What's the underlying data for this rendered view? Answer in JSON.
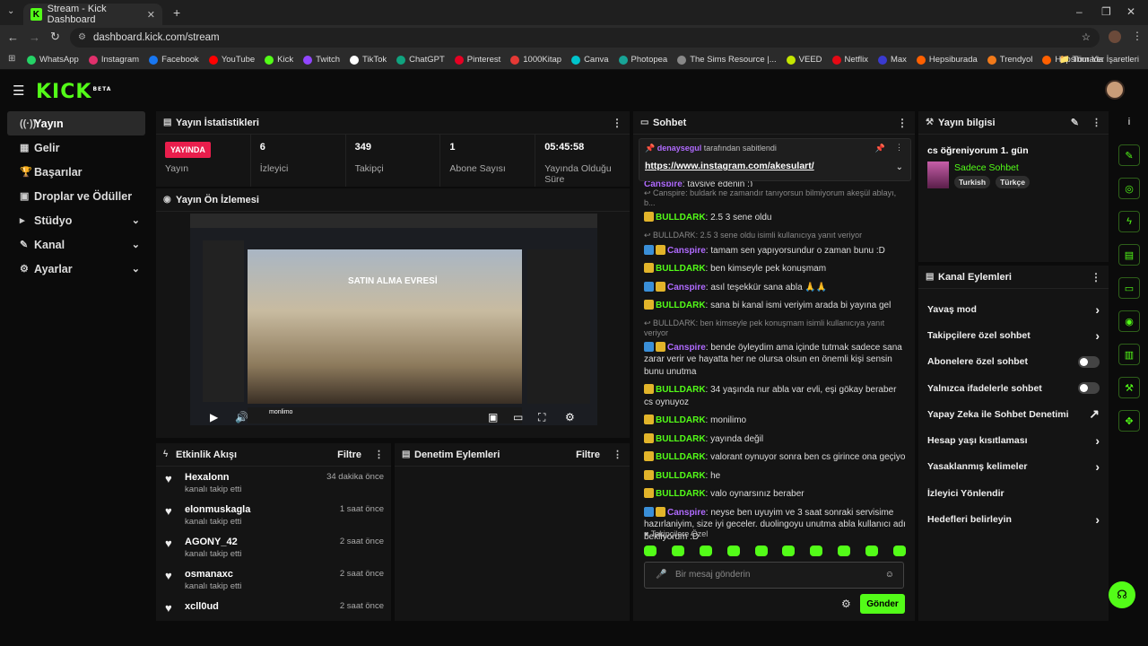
{
  "browser": {
    "tab_title": "Stream - Kick Dashboard",
    "url": "dashboard.kick.com/stream",
    "bookmarks": [
      {
        "label": "WhatsApp",
        "color": "#25d366"
      },
      {
        "label": "Instagram",
        "color": "#e1306c"
      },
      {
        "label": "Facebook",
        "color": "#1877f2"
      },
      {
        "label": "YouTube",
        "color": "#ff0000"
      },
      {
        "label": "Kick",
        "color": "#53fc18"
      },
      {
        "label": "Twitch",
        "color": "#9146ff"
      },
      {
        "label": "TikTok",
        "color": "#ffffff"
      },
      {
        "label": "ChatGPT",
        "color": "#10a37f"
      },
      {
        "label": "Pinterest",
        "color": "#e60023"
      },
      {
        "label": "1000Kitap",
        "color": "#e53935"
      },
      {
        "label": "Canva",
        "color": "#00c4cc"
      },
      {
        "label": "Photopea",
        "color": "#18a497"
      },
      {
        "label": "The Sims Resource |...",
        "color": "#888888"
      },
      {
        "label": "VEED",
        "color": "#c4e600"
      },
      {
        "label": "Netflix",
        "color": "#e50914"
      },
      {
        "label": "Max",
        "color": "#3a3ad0"
      },
      {
        "label": "Hepsiburada",
        "color": "#ff6000"
      },
      {
        "label": "Trendyol",
        "color": "#f27a1a"
      },
      {
        "label": "Hepsiburada",
        "color": "#ff6000"
      }
    ],
    "all_bookmarks": "Tüm Yer İşaretleri"
  },
  "app": {
    "logo": "KICK",
    "logo_sup": "BETA",
    "accent": "#53fc18"
  },
  "sidebar": {
    "items": [
      {
        "label": "Yayın",
        "icon": "broadcast-icon",
        "glyph": "((·))",
        "chev": ""
      },
      {
        "label": "Gelir",
        "icon": "revenue-icon",
        "glyph": "▦",
        "chev": ""
      },
      {
        "label": "Başarılar",
        "icon": "trophy-icon",
        "glyph": "🏆",
        "chev": ""
      },
      {
        "label": "Droplar ve Ödüller",
        "icon": "gift-icon",
        "glyph": "▣",
        "chev": ""
      },
      {
        "label": "Stüdyo",
        "icon": "studio-icon",
        "glyph": "▸",
        "chev": "⌄"
      },
      {
        "label": "Kanal",
        "icon": "channel-icon",
        "glyph": "✎",
        "chev": "⌄"
      },
      {
        "label": "Ayarlar",
        "icon": "settings-icon",
        "glyph": "⚙",
        "chev": "⌄"
      }
    ]
  },
  "stats": {
    "title": "Yayın İstatistikleri",
    "live_label": "YAYINDA",
    "live_caption": "Yayın",
    "items": [
      {
        "value": "6",
        "label": "İzleyici"
      },
      {
        "value": "349",
        "label": "Takipçi"
      },
      {
        "value": "1",
        "label": "Abone Sayısı"
      },
      {
        "value": "05:45:58",
        "label": "Yayında Olduğu Süre"
      }
    ]
  },
  "preview": {
    "title": "Yayın Ön İzlemesi",
    "overlay_text": "SATIN ALMA EVRESİ",
    "chat_user": "monlimo"
  },
  "activity": {
    "title": "Etkinlik Akışı",
    "filter": "Filtre",
    "events": [
      {
        "name": "Hexalonn",
        "desc": "kanalı takip etti",
        "time": "34 dakika önce"
      },
      {
        "name": "elonmuskagla",
        "desc": "kanalı takip etti",
        "time": "1 saat önce"
      },
      {
        "name": "AGONY_42",
        "desc": "kanalı takip etti",
        "time": "2 saat önce"
      },
      {
        "name": "osmanaxc",
        "desc": "kanalı takip etti",
        "time": "2 saat önce"
      },
      {
        "name": "xcll0ud",
        "desc": "",
        "time": "2 saat önce"
      }
    ]
  },
  "moderation": {
    "title": "Denetim Eylemleri",
    "filter": "Filtre"
  },
  "chat": {
    "title": "Sohbet",
    "pinned_by": "denaysegul",
    "pinned_suffix": "tarafından sabitlendi",
    "pinned_link": "https://www.instagram.com/akesulart/",
    "top_partial_user": "Canspire",
    "top_partial_text": ": tavsiye edenin :)",
    "messages": [
      {
        "type": "reply",
        "text": "Canspire: buldark ne zamandır tanıyorsun bilmiyorum akeşül ablayı, b..."
      },
      {
        "type": "msg",
        "user": "BULLDARK",
        "color": "green",
        "text": ": 2.5 3 sene oldu"
      },
      {
        "type": "reply",
        "text": "BULLDARK: 2.5 3 sene oldu isimli kullanıcıya yanıt veriyor"
      },
      {
        "type": "msg",
        "user": "Canspire",
        "color": "purple",
        "text": ": tamam sen yapıyorsundur o zaman bunu :D"
      },
      {
        "type": "msg",
        "user": "BULLDARK",
        "color": "green",
        "text": ": ben kimseyle pek konuşmam"
      },
      {
        "type": "msg",
        "user": "Canspire",
        "color": "purple",
        "text": ": asıl teşekkür sana abla 🙏🙏"
      },
      {
        "type": "msg",
        "user": "BULLDARK",
        "color": "green",
        "text": ": sana bi kanal ismi veriyim arada bi yayına gel"
      },
      {
        "type": "reply",
        "text": "BULLDARK: ben kimseyle pek konuşmam isimli kullanıcıya yanıt veriyor"
      },
      {
        "type": "msg",
        "user": "Canspire",
        "color": "purple",
        "text": ": bende öyleydim ama içinde tutmak sadece sana zarar verir ve hayatta her ne olursa olsun en önemli kişi sensin bunu unutma"
      },
      {
        "type": "msg",
        "user": "BULLDARK",
        "color": "green",
        "text": ": 34 yaşında nur abla var evli, eşi gökay beraber cs oynuyoz"
      },
      {
        "type": "msg",
        "user": "BULLDARK",
        "color": "green",
        "text": ": monilimo"
      },
      {
        "type": "msg",
        "user": "BULLDARK",
        "color": "green",
        "text": ": yayında değil"
      },
      {
        "type": "msg",
        "user": "BULLDARK",
        "color": "green",
        "text": ": valorant oynuyor sonra ben cs girince ona geçiyo"
      },
      {
        "type": "msg",
        "user": "BULLDARK",
        "color": "green",
        "text": ": he"
      },
      {
        "type": "msg",
        "user": "BULLDARK",
        "color": "green",
        "text": ": valo oynarsınız beraber"
      },
      {
        "type": "msg",
        "user": "Canspire",
        "color": "purple",
        "text": ": neyse ben uyuyim ve 3 saat sonraki servisime hazırlaniyim, size iyi geceler. duolingoyu unutma abla kullanıcı adı bekliyorum :D"
      }
    ],
    "followers_only": "Takipçilere Özel",
    "input_placeholder": "Bir mesaj gönderin",
    "send": "Gönder"
  },
  "stream_info": {
    "title": "Yayın bilgisi",
    "stream_title": "cs öğreniyorum 1. gün",
    "category": "Sadece Sohbet",
    "tags": [
      "Turkish",
      "Türkçe"
    ]
  },
  "channel_actions": {
    "title": "Kanal Eylemleri",
    "items": [
      {
        "label": "Yavaş mod",
        "kind": "chevron",
        "right": "›"
      },
      {
        "label": "Takipçilere özel sohbet",
        "kind": "chevron",
        "right": "›"
      },
      {
        "label": "Abonelere özel sohbet",
        "kind": "toggle",
        "right": ""
      },
      {
        "label": "Yalnızca ifadelerle sohbet",
        "kind": "toggle",
        "right": ""
      },
      {
        "label": "Yapay Zeka ile Sohbet Denetimi",
        "kind": "external",
        "right": "↗"
      },
      {
        "label": "Hesap yaşı kısıtlaması",
        "kind": "chevron",
        "right": "›"
      },
      {
        "label": "Yasaklanmış kelimeler",
        "kind": "chevron",
        "right": "›"
      },
      {
        "label": "İzleyici Yönlendir",
        "kind": "none",
        "right": ""
      },
      {
        "label": "Hedefleri belirleyin",
        "kind": "chevron",
        "right": "›"
      }
    ]
  },
  "rail": [
    {
      "icon": "info-icon",
      "glyph": "i"
    },
    {
      "icon": "edit-icon",
      "glyph": "✎"
    },
    {
      "icon": "target-icon",
      "glyph": "◎"
    },
    {
      "icon": "bolt-icon",
      "glyph": "ϟ"
    },
    {
      "icon": "document-icon",
      "glyph": "▤"
    },
    {
      "icon": "chat-icon",
      "glyph": "▭"
    },
    {
      "icon": "broadcast-icon",
      "glyph": "◉"
    },
    {
      "icon": "layout-icon",
      "glyph": "▥"
    },
    {
      "icon": "wrench-icon",
      "glyph": "⚒"
    },
    {
      "icon": "apps-icon",
      "glyph": "✥"
    }
  ]
}
